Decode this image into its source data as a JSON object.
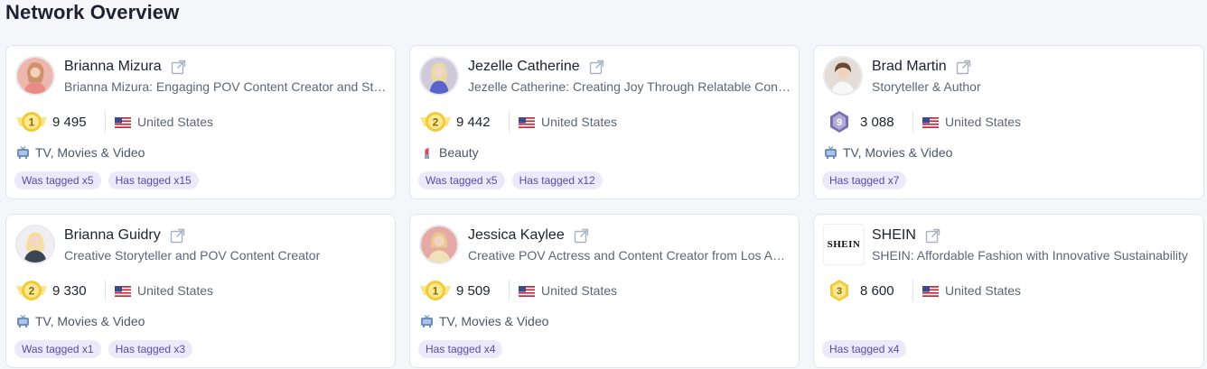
{
  "page": {
    "title": "Network Overview"
  },
  "cards": [
    {
      "name": "Brianna Mizura",
      "desc": "Brianna Mizura: Engaging POV Content Creator and Storyteller",
      "rank": "1",
      "count": "9 495",
      "country": "United States",
      "category": "TV, Movies & Video",
      "tags": [
        "Was tagged x5",
        "Has tagged x15"
      ],
      "avatar_bg": "#e9a79b"
    },
    {
      "name": "Jezelle Catherine",
      "desc": "Jezelle Catherine: Creating Joy Through Relatable Content",
      "rank": "2",
      "count": "9 442",
      "country": "United States",
      "category": "Beauty",
      "tags": [
        "Was tagged x5",
        "Has tagged x12"
      ],
      "avatar_bg": "#c9c2d8"
    },
    {
      "name": "Brad Martin",
      "desc": "Storyteller & Author",
      "rank": "9",
      "count": "3 088",
      "country": "United States",
      "category": "TV, Movies & Video",
      "tags": [
        "Has tagged x7"
      ],
      "avatar_bg": "#d8c3b3"
    },
    {
      "name": "Brianna Guidry",
      "desc": "Creative Storyteller and POV Content Creator",
      "rank": "2",
      "count": "9 330",
      "country": "United States",
      "category": "TV, Movies & Video",
      "tags": [
        "Was tagged x1",
        "Has tagged x3"
      ],
      "avatar_bg": "#e7e4ea"
    },
    {
      "name": "Jessica Kaylee",
      "desc": "Creative POV Actress and Content Creator from Los Angeles",
      "rank": "1",
      "count": "9 509",
      "country": "United States",
      "category": "TV, Movies & Video",
      "tags": [
        "Has tagged x4"
      ],
      "avatar_bg": "#e1a3a0"
    },
    {
      "name": "SHEIN",
      "desc": "SHEIN: Affordable Fashion with Innovative Sustainability",
      "rank": "3",
      "count": "8 600",
      "country": "United States",
      "category": "",
      "tags": [
        "Has tagged x4"
      ],
      "logo_text": "SHEIN"
    }
  ],
  "colors": {
    "gold": "#f3c93a",
    "gold_light": "#fde98f",
    "purple_badge": "#7a6fb0",
    "tag_bg": "#ece9fb",
    "tag_text": "#5b4ba8"
  },
  "icons": {
    "external": "external-link-icon",
    "flag": "us-flag-icon",
    "tv": "tv-icon",
    "beauty": "lipstick-icon",
    "rank": "rank-medal-icon"
  }
}
